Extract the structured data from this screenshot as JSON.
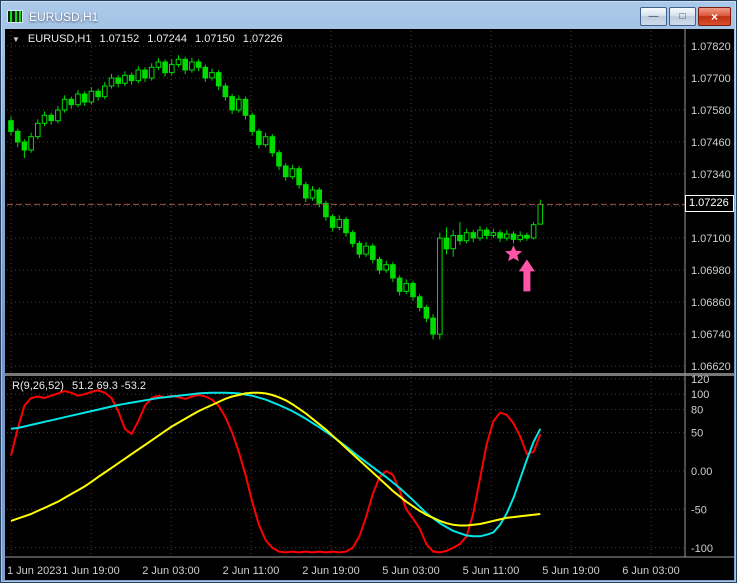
{
  "window": {
    "title": "EURUSD,H1",
    "controls": {
      "minimize": "—",
      "maximize": "□",
      "close": "×"
    }
  },
  "header": {
    "collapse_icon": "▼",
    "symbol_period": "EURUSD,H1",
    "ohlc": [
      "1.07152",
      "1.07244",
      "1.07150",
      "1.07226"
    ]
  },
  "price_axis": {
    "labels": [
      "1.07820",
      "1.07700",
      "1.07580",
      "1.07460",
      "1.07340",
      "1.07100",
      "1.06980",
      "1.06860",
      "1.06740",
      "1.06620"
    ],
    "current_price": "1.07226"
  },
  "indicator": {
    "name": "R(9,26,52)",
    "values": "51.2 69.3 -53.2",
    "axis_labels": [
      "120",
      "100",
      "80",
      "50",
      "0.00",
      "-50",
      "-100"
    ]
  },
  "time_axis": {
    "labels": [
      "1 Jun 2023",
      "1 Jun 19:00",
      "2 Jun 03:00",
      "2 Jun 11:00",
      "2 Jun 19:00",
      "5 Jun 03:00",
      "5 Jun 11:00",
      "5 Jun 19:00",
      "6 Jun 03:00"
    ]
  },
  "colors": {
    "background": "#000000",
    "grid": "#7a2828",
    "candle": "#00DC00",
    "axis_text": "#CFCFCF",
    "separator": "#9a9a9a",
    "divider": "#787878",
    "current_price_line": "#9a5555",
    "marker": "#FF54A8",
    "indicator_red": "#FF0000",
    "indicator_aqua": "#00E5E5",
    "indicator_yellow": "#FFFF00"
  },
  "chart_data": {
    "type": "candlestick",
    "title": "EURUSD,H1",
    "price_axis_range": [
      1.0662,
      1.0782
    ],
    "grid": {
      "top": 1.0782,
      "step": 0.0012,
      "count": 11
    },
    "candles": [
      [
        1.0754,
        1.07555,
        1.07485,
        1.075
      ],
      [
        1.075,
        1.0751,
        1.0744,
        1.0746
      ],
      [
        1.0746,
        1.0747,
        1.074,
        1.0743
      ],
      [
        1.0743,
        1.07495,
        1.0742,
        1.0748
      ],
      [
        1.0748,
        1.07545,
        1.0747,
        1.0753
      ],
      [
        1.0753,
        1.07575,
        1.0752,
        1.0756
      ],
      [
        1.0756,
        1.0757,
        1.07525,
        1.0754
      ],
      [
        1.0754,
        1.07595,
        1.0753,
        1.0758
      ],
      [
        1.0758,
        1.07635,
        1.0757,
        1.0762
      ],
      [
        1.0762,
        1.0763,
        1.07585,
        1.076
      ],
      [
        1.076,
        1.07655,
        1.0759,
        1.0764
      ],
      [
        1.0764,
        1.0765,
        1.07595,
        1.0761
      ],
      [
        1.0761,
        1.07665,
        1.076,
        1.0765
      ],
      [
        1.0765,
        1.0766,
        1.07615,
        1.0763
      ],
      [
        1.0763,
        1.07685,
        1.0762,
        1.0767
      ],
      [
        1.0767,
        1.07715,
        1.0766,
        1.077
      ],
      [
        1.077,
        1.0771,
        1.07665,
        1.0768
      ],
      [
        1.0768,
        1.07725,
        1.0767,
        1.0771
      ],
      [
        1.0771,
        1.0772,
        1.07675,
        1.0769
      ],
      [
        1.0769,
        1.07745,
        1.0768,
        1.0773
      ],
      [
        1.0773,
        1.0774,
        1.07685,
        1.077
      ],
      [
        1.077,
        1.07755,
        1.0769,
        1.0774
      ],
      [
        1.0774,
        1.07775,
        1.0773,
        1.0776
      ],
      [
        1.0776,
        1.0777,
        1.07705,
        1.0772
      ],
      [
        1.0772,
        1.0777,
        1.0771,
        1.0775
      ],
      [
        1.0775,
        1.07785,
        1.0774,
        1.0777
      ],
      [
        1.0777,
        1.0778,
        1.07715,
        1.0773
      ],
      [
        1.0773,
        1.07775,
        1.0772,
        1.0776
      ],
      [
        1.0776,
        1.0777,
        1.07725,
        1.0774
      ],
      [
        1.0774,
        1.0775,
        1.07685,
        1.077
      ],
      [
        1.077,
        1.07735,
        1.0769,
        1.0772
      ],
      [
        1.0772,
        1.0773,
        1.07655,
        1.0767
      ],
      [
        1.0767,
        1.0768,
        1.07615,
        1.0763
      ],
      [
        1.0763,
        1.0764,
        1.07565,
        1.0758
      ],
      [
        1.0758,
        1.07635,
        1.0757,
        1.0762
      ],
      [
        1.0762,
        1.0763,
        1.07545,
        1.0756
      ],
      [
        1.0756,
        1.0757,
        1.07485,
        1.075
      ],
      [
        1.075,
        1.0751,
        1.07435,
        1.0745
      ],
      [
        1.0745,
        1.07495,
        1.0744,
        1.0748
      ],
      [
        1.0748,
        1.0749,
        1.07405,
        1.0742
      ],
      [
        1.0742,
        1.0743,
        1.07355,
        1.0737
      ],
      [
        1.0737,
        1.0738,
        1.07315,
        1.0733
      ],
      [
        1.0733,
        1.07375,
        1.0732,
        1.0736
      ],
      [
        1.0736,
        1.0737,
        1.07285,
        1.073
      ],
      [
        1.073,
        1.0731,
        1.07235,
        1.0725
      ],
      [
        1.0725,
        1.07295,
        1.0724,
        1.0728
      ],
      [
        1.0728,
        1.0729,
        1.07215,
        1.0723
      ],
      [
        1.0723,
        1.0724,
        1.07165,
        1.0718
      ],
      [
        1.0718,
        1.0719,
        1.07125,
        1.0714
      ],
      [
        1.0714,
        1.07185,
        1.0713,
        1.0717
      ],
      [
        1.0717,
        1.0718,
        1.07105,
        1.0712
      ],
      [
        1.0712,
        1.0713,
        1.07065,
        1.0708
      ],
      [
        1.0708,
        1.0709,
        1.07025,
        1.0704
      ],
      [
        1.0704,
        1.07085,
        1.0703,
        1.0707
      ],
      [
        1.0707,
        1.0708,
        1.07005,
        1.0702
      ],
      [
        1.0702,
        1.0703,
        1.06965,
        1.0698
      ],
      [
        1.0698,
        1.07015,
        1.0697,
        1.07
      ],
      [
        1.07,
        1.0701,
        1.06935,
        1.0695
      ],
      [
        1.0695,
        1.0696,
        1.06885,
        1.069
      ],
      [
        1.069,
        1.06945,
        1.0689,
        1.0693
      ],
      [
        1.0693,
        1.0694,
        1.06865,
        1.0688
      ],
      [
        1.0688,
        1.0689,
        1.06825,
        1.0684
      ],
      [
        1.0684,
        1.0685,
        1.06785,
        1.068
      ],
      [
        1.068,
        1.06815,
        1.0672,
        1.0674
      ],
      [
        1.0674,
        1.0712,
        1.0672,
        1.071
      ],
      [
        1.071,
        1.0714,
        1.0704,
        1.0706
      ],
      [
        1.0706,
        1.0713,
        1.0703,
        1.0711
      ],
      [
        1.0711,
        1.0716,
        1.07075,
        1.0709
      ],
      [
        1.0709,
        1.07135,
        1.0708,
        1.0712
      ],
      [
        1.0712,
        1.0713,
        1.07085,
        1.071
      ],
      [
        1.071,
        1.07145,
        1.0709,
        1.0713
      ],
      [
        1.0713,
        1.0714,
        1.07095,
        1.0711
      ],
      [
        1.0711,
        1.07135,
        1.071,
        1.0712
      ],
      [
        1.0712,
        1.0713,
        1.07085,
        1.071
      ],
      [
        1.071,
        1.0713,
        1.0709,
        1.07115
      ],
      [
        1.07115,
        1.07125,
        1.0708,
        1.07095
      ],
      [
        1.07095,
        1.07125,
        1.07085,
        1.0711
      ],
      [
        1.0711,
        1.0712,
        1.0709,
        1.071
      ],
      [
        1.071,
        1.0716,
        1.07095,
        1.0715
      ],
      [
        1.07152,
        1.07244,
        1.0715,
        1.07226
      ]
    ],
    "marker": {
      "type": "buy-signal",
      "color": "#FF54A8",
      "star": {
        "bar": 75,
        "price": 1.0704
      },
      "arrow": {
        "bar": 77,
        "tip_price": 1.0702,
        "base_price": 1.069
      }
    },
    "indicator": {
      "name": "R(9,26,52)",
      "current_values": [
        51.2,
        69.3,
        -53.2
      ],
      "range": [
        -120,
        120
      ],
      "series": [
        {
          "name": "red-line",
          "color": "#FF0000",
          "values": [
            20,
            55,
            85,
            95,
            97,
            95,
            98,
            101,
            104,
            102,
            98,
            100,
            103,
            105,
            102,
            95,
            78,
            55,
            48,
            65,
            85,
            95,
            98,
            96,
            98,
            96,
            94,
            97,
            99,
            97,
            93,
            85,
            70,
            50,
            25,
            -5,
            -40,
            -70,
            -90,
            -100,
            -105,
            -106,
            -105,
            -106,
            -105,
            -106,
            -105,
            -106,
            -105,
            -106,
            -105,
            -100,
            -85,
            -60,
            -30,
            -8,
            0,
            -5,
            -25,
            -50,
            -62,
            -75,
            -95,
            -105,
            -106,
            -104,
            -100,
            -95,
            -85,
            -55,
            -10,
            35,
            65,
            76,
            73,
            62,
            45,
            22,
            25,
            48
          ]
        },
        {
          "name": "aqua-line",
          "color": "#00E5E5",
          "values": [
            55,
            56,
            58,
            60,
            62,
            64,
            66,
            68,
            70,
            72,
            74,
            76,
            78,
            80,
            82,
            84,
            86,
            87.5,
            89,
            90.5,
            92,
            93.5,
            95,
            96,
            97,
            98,
            99,
            100,
            101,
            101.5,
            102,
            102,
            102,
            101.5,
            101,
            99.5,
            98,
            95.5,
            93,
            89.5,
            86,
            82,
            78,
            73,
            68,
            62.5,
            57,
            51,
            45,
            38.5,
            32,
            25,
            18,
            11.5,
            5,
            -1.5,
            -8,
            -15,
            -22,
            -30,
            -38,
            -46.5,
            -55,
            -61.5,
            -68,
            -73,
            -78,
            -81,
            -84,
            -85,
            -85,
            -83,
            -80,
            -70,
            -55,
            -35,
            -10,
            15,
            38,
            55
          ]
        },
        {
          "name": "yellow-line",
          "color": "#FFFF00",
          "values": [
            -65,
            -62,
            -59,
            -56,
            -52,
            -48,
            -44,
            -40,
            -35,
            -30,
            -25,
            -20,
            -14,
            -8,
            -2,
            4,
            10,
            16,
            22,
            28,
            34,
            40,
            46,
            52,
            58,
            63,
            68,
            73,
            78,
            82,
            86,
            90,
            94,
            97,
            99,
            101,
            102,
            102,
            101,
            99,
            96,
            92,
            87,
            81,
            75,
            68,
            61,
            54,
            46,
            38,
            30,
            22,
            14,
            6,
            -2,
            -10,
            -18,
            -26,
            -33,
            -40,
            -46,
            -52,
            -57,
            -61,
            -65,
            -68,
            -70,
            -71,
            -71,
            -70,
            -69,
            -67,
            -65,
            -63,
            -61,
            -60,
            -59,
            -58,
            -57,
            -56
          ]
        }
      ]
    }
  }
}
